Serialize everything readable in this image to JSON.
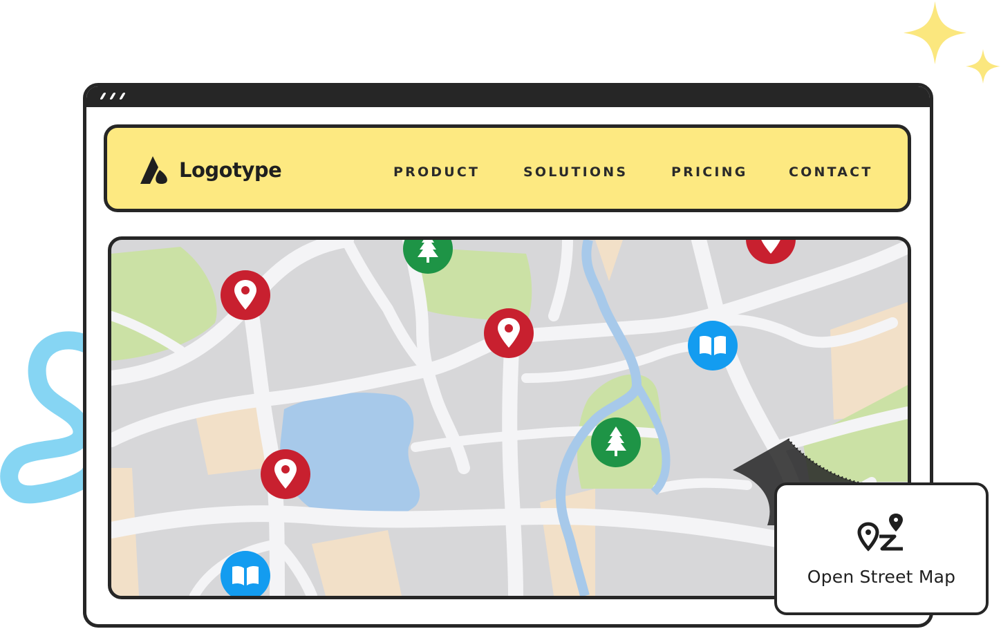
{
  "brand": {
    "name": "Logotype",
    "icon": "logo-mark-icon"
  },
  "nav": {
    "items": [
      {
        "label": "PRODUCT"
      },
      {
        "label": "SOLUTIONS"
      },
      {
        "label": "PRICING"
      },
      {
        "label": "CONTACT"
      }
    ]
  },
  "map": {
    "markers": [
      {
        "type": "location-pin",
        "icon": "location-pin-icon"
      },
      {
        "type": "location-pin",
        "icon": "location-pin-icon"
      },
      {
        "type": "location-pin",
        "icon": "location-pin-icon"
      },
      {
        "type": "location-pin",
        "icon": "location-pin-icon"
      },
      {
        "type": "park",
        "icon": "tree-icon"
      },
      {
        "type": "park",
        "icon": "tree-icon"
      },
      {
        "type": "library",
        "icon": "book-icon"
      },
      {
        "type": "library",
        "icon": "book-icon"
      }
    ]
  },
  "card": {
    "label": "Open Street Map",
    "icon": "route-icon"
  },
  "colors": {
    "navbar": "#fde981",
    "frame": "#262626",
    "pin_red": "#c8202f",
    "park_green": "#1e9446",
    "book_blue": "#139cf0",
    "water": "#a7c9ea",
    "park_area": "#cbe1a5",
    "sand_area": "#f2e0c8",
    "road": "#f4f4f6",
    "land": "#d7d7d9",
    "sparkle": "#fbe77e",
    "squiggle": "#7fd3f2"
  }
}
